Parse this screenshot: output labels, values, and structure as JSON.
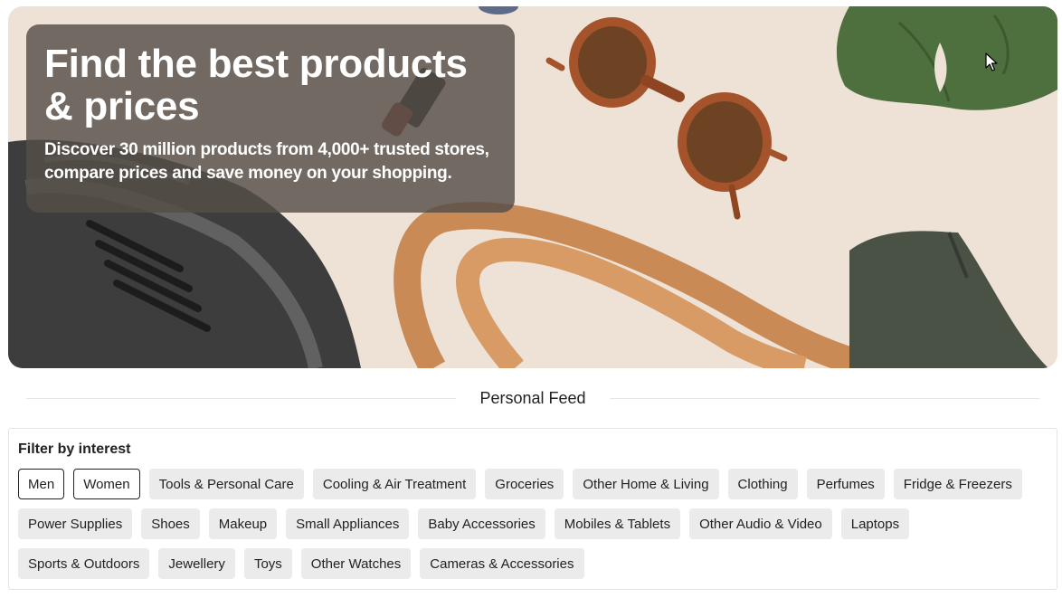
{
  "hero": {
    "title": "Find the best products & prices",
    "subtitle": "Discover 30 million products from 4,000+ trusted stores, compare prices and save money on your shopping."
  },
  "feed": {
    "title": "Personal Feed"
  },
  "filter": {
    "label": "Filter by interest",
    "chips": [
      {
        "label": "Men",
        "selected": true
      },
      {
        "label": "Women",
        "selected": true
      },
      {
        "label": "Tools & Personal Care",
        "selected": false
      },
      {
        "label": "Cooling & Air Treatment",
        "selected": false
      },
      {
        "label": "Groceries",
        "selected": false
      },
      {
        "label": "Other Home & Living",
        "selected": false
      },
      {
        "label": "Clothing",
        "selected": false
      },
      {
        "label": "Perfumes",
        "selected": false
      },
      {
        "label": "Fridge & Freezers",
        "selected": false
      },
      {
        "label": "Power Supplies",
        "selected": false
      },
      {
        "label": "Shoes",
        "selected": false
      },
      {
        "label": "Makeup",
        "selected": false
      },
      {
        "label": "Small Appliances",
        "selected": false
      },
      {
        "label": "Baby Accessories",
        "selected": false
      },
      {
        "label": "Mobiles & Tablets",
        "selected": false
      },
      {
        "label": "Other Audio & Video",
        "selected": false
      },
      {
        "label": "Laptops",
        "selected": false
      },
      {
        "label": "Sports & Outdoors",
        "selected": false
      },
      {
        "label": "Jewellery",
        "selected": false
      },
      {
        "label": "Toys",
        "selected": false
      },
      {
        "label": "Other Watches",
        "selected": false
      },
      {
        "label": "Cameras & Accessories",
        "selected": false
      }
    ]
  },
  "colors": {
    "hero_background": "#eee2d6",
    "chip_background": "#ebebeb",
    "chip_selected_border": "#222222"
  },
  "icons": [
    "mouse-cursor-icon"
  ]
}
